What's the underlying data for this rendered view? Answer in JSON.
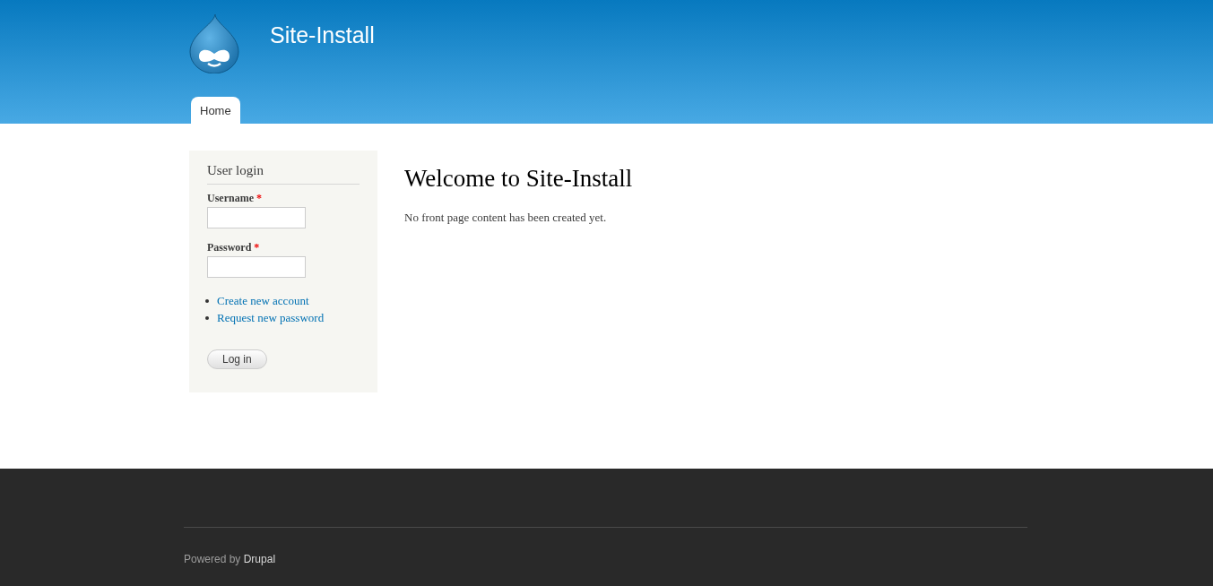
{
  "header": {
    "site_name": "Site-Install"
  },
  "tabs": [
    {
      "label": "Home",
      "selected": true
    }
  ],
  "login_block": {
    "title": "User login",
    "fields": [
      {
        "label": "Username",
        "required_mark": "*"
      },
      {
        "label": "Password",
        "required_mark": "*"
      }
    ],
    "links": [
      "Create new account",
      "Request new password"
    ],
    "button": "Log in"
  },
  "main": {
    "title": "Welcome to Site-Install",
    "text": "No front page content has been created yet."
  },
  "footer": {
    "text": "Powered by",
    "link": "Drupal"
  }
}
